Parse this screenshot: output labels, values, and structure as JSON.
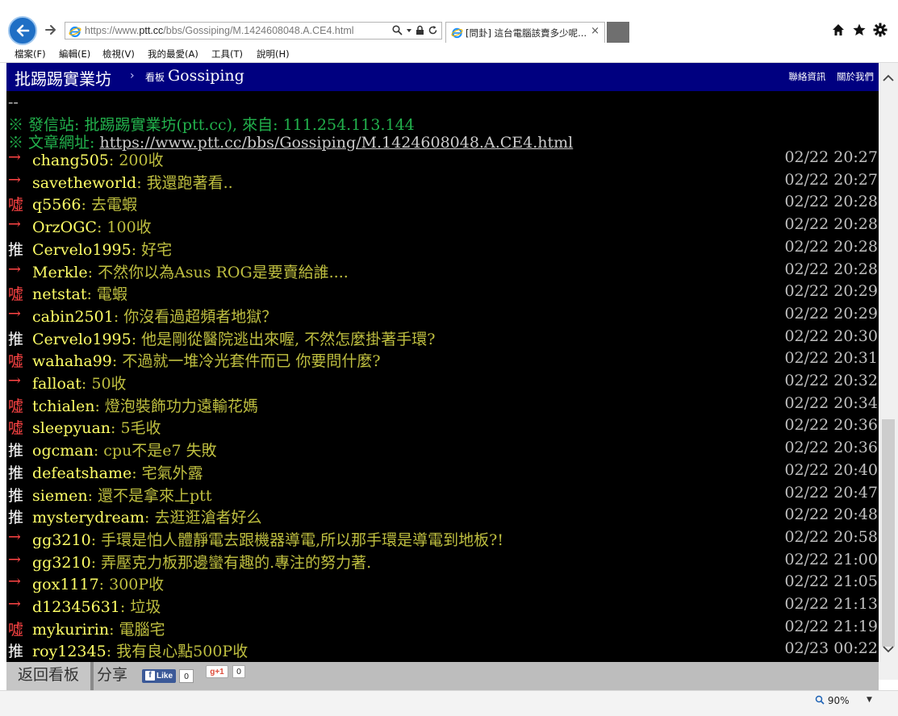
{
  "browser": {
    "address_prefix": "https://www.",
    "address_host": "ptt.cc",
    "address_path": "/bbs/Gossiping/M.1424608048.A.CE4.html",
    "tab_title": "[問卦] 這台電腦該賣多少呢...",
    "tab_close": "×",
    "zoom": "90%",
    "menu": [
      "檔案(F)",
      "編輯(E)",
      "檢視(V)",
      "我的最愛(A)",
      "工具(T)",
      "說明(H)"
    ]
  },
  "header": {
    "site_name": "批踢踢實業坊",
    "chevron": "›",
    "board_tag": "看板",
    "board_name": "Gossiping",
    "link_contact": "聯絡資訊",
    "link_about": "關於我們"
  },
  "signature": {
    "dash": "--",
    "station": "※ 發信站: 批踢踢實業坊(ptt.cc), 來自: 111.254.113.144",
    "url_label": "※ 文章網址: ",
    "url": "https://www.ptt.cc/bbs/Gossiping/M.1424608048.A.CE4.html"
  },
  "pushes": [
    {
      "tag": "→",
      "type": "arrow",
      "user": "chang505",
      "content": ": 200收",
      "time": "02/22 20:27"
    },
    {
      "tag": "→",
      "type": "arrow",
      "user": "savetheworld",
      "content": ": 我還跑著看..",
      "time": "02/22 20:27"
    },
    {
      "tag": "噓",
      "type": "boo",
      "user": "q5566",
      "content": ": 去電蝦",
      "time": "02/22 20:28"
    },
    {
      "tag": "→",
      "type": "arrow",
      "user": "OrzOGC",
      "content": ": 100收",
      "time": "02/22 20:28"
    },
    {
      "tag": "推",
      "type": "push",
      "user": "Cervelo1995",
      "content": ": 好宅",
      "time": "02/22 20:28"
    },
    {
      "tag": "→",
      "type": "arrow",
      "user": "Merkle",
      "content": ": 不然你以為Asus ROG是要賣給誰....",
      "time": "02/22 20:28"
    },
    {
      "tag": "噓",
      "type": "boo",
      "user": "netstat",
      "content": ": 電蝦",
      "time": "02/22 20:29"
    },
    {
      "tag": "→",
      "type": "arrow",
      "user": "cabin2501",
      "content": ": 你沒看過超頻者地獄？",
      "time": "02/22 20:29"
    },
    {
      "tag": "推",
      "type": "push",
      "user": "Cervelo1995",
      "content": ": 他是剛從醫院逃出來喔, 不然怎麼掛著手環?",
      "time": "02/22 20:30"
    },
    {
      "tag": "噓",
      "type": "boo",
      "user": "wahaha99",
      "content": ": 不過就一堆冷光套件而已 你要問什麼?",
      "time": "02/22 20:31"
    },
    {
      "tag": "→",
      "type": "arrow",
      "user": "falloat",
      "content": ": 50收",
      "time": "02/22 20:32"
    },
    {
      "tag": "噓",
      "type": "boo",
      "user": "tchialen",
      "content": ": 燈泡裝飾功力遠輸花媽",
      "time": "02/22 20:34"
    },
    {
      "tag": "噓",
      "type": "boo",
      "user": "sleepyuan",
      "content": ": 5毛收",
      "time": "02/22 20:36"
    },
    {
      "tag": "推",
      "type": "push",
      "user": "ogcman",
      "content": ": cpu不是e7 失敗",
      "time": "02/22 20:36"
    },
    {
      "tag": "推",
      "type": "push",
      "user": "defeatshame",
      "content": ": 宅氣外露",
      "time": "02/22 20:40"
    },
    {
      "tag": "推",
      "type": "push",
      "user": "siemen",
      "content": ": 還不是拿來上ptt",
      "time": "02/22 20:47"
    },
    {
      "tag": "推",
      "type": "push",
      "user": "mysterydream",
      "content": ": 去逛逛滄者好么",
      "time": "02/22 20:48"
    },
    {
      "tag": "→",
      "type": "arrow",
      "user": "gg3210",
      "content": ": 手環是怕人體靜電去跟機器導電,所以那手環是導電到地板?!",
      "time": "02/22 20:58"
    },
    {
      "tag": "→",
      "type": "arrow",
      "user": "gg3210",
      "content": ": 弄壓克力板那邊蠻有趣的.專注的努力著.",
      "time": "02/22 21:00"
    },
    {
      "tag": "→",
      "type": "arrow",
      "user": "gox1117",
      "content": ": 300P收",
      "time": "02/22 21:05"
    },
    {
      "tag": "→",
      "type": "arrow",
      "user": "d12345631",
      "content": ": 垃圾",
      "time": "02/22 21:13"
    },
    {
      "tag": "噓",
      "type": "boo",
      "user": "mykuririn",
      "content": ": 電腦宅",
      "time": "02/22 21:19"
    },
    {
      "tag": "推",
      "type": "push",
      "user": "roy12345",
      "content": ": 我有良心點500P收",
      "time": "02/23 00:22"
    }
  ],
  "footer": {
    "back_board": "返回看板",
    "share": "分享",
    "fb_like": "Like",
    "fb_count": "0",
    "gplus": "g+1",
    "gplus_count": "0"
  },
  "colors": {
    "header_bg": "#000080",
    "content_bg": "#000000",
    "userid": "#ffff66",
    "content_text": "#bfbf40",
    "signature": "#22b14c",
    "boo_arrow": "#ff4444"
  }
}
